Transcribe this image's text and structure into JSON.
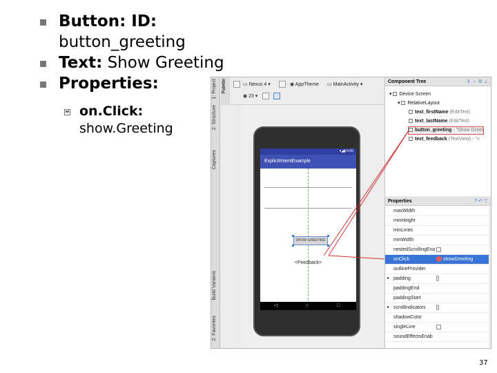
{
  "slide": {
    "bullets": [
      {
        "key": "Button: ID:",
        "value": "button_greeting"
      },
      {
        "key": "Text:",
        "value": "Show Greeting"
      },
      {
        "key": "Properties:",
        "value": ""
      }
    ],
    "sub_bullet": {
      "key": "on.Click:",
      "value": "show.Greeting"
    },
    "page_number": "37"
  },
  "ide": {
    "side_tabs": [
      "1: Project",
      "2: Structure",
      "Captures",
      "Build Variants",
      "2: Favorites"
    ],
    "palette_tab": "Palette",
    "toolbar": {
      "device": "Nexus 4",
      "theme": "AppTheme",
      "activity": "MainActivity",
      "api": "23"
    },
    "preview": {
      "status_time": "6:00",
      "app_title": "ExplicitIntentExample",
      "button_text": "SHOW GREETING",
      "feedback_text": "<Feedback>",
      "nav_back": "◁",
      "nav_home": "○",
      "nav_recent": "□"
    },
    "component_tree": {
      "title": "Component Tree",
      "nodes": [
        {
          "name": "Device Screen",
          "detail": "",
          "depth": 0
        },
        {
          "name": "RelativeLayout",
          "detail": "",
          "depth": 1
        },
        {
          "name": "text_firstName",
          "detail": "(EditText)",
          "depth": 2
        },
        {
          "name": "text_lastName",
          "detail": "(EditText)",
          "depth": 2
        },
        {
          "name": "button_greeting",
          "detail": "- \"Show Greet",
          "depth": 2
        },
        {
          "name": "text_feedback",
          "detail": "(TextView) - \"<",
          "depth": 2
        }
      ]
    },
    "properties": {
      "title": "Properties",
      "rows": [
        {
          "name": "maxWidth",
          "value": ""
        },
        {
          "name": "minHeight",
          "value": ""
        },
        {
          "name": "minLines",
          "value": ""
        },
        {
          "name": "minWidth",
          "value": ""
        },
        {
          "name": "nestedScrollingEna",
          "value": "checkbox"
        },
        {
          "name": "onClick",
          "value": "showGreeting"
        },
        {
          "name": "outlineProvider",
          "value": ""
        },
        {
          "name": "padding",
          "value": "[]"
        },
        {
          "name": "paddingEnd",
          "value": ""
        },
        {
          "name": "paddingStart",
          "value": ""
        },
        {
          "name": "scrollIndicators",
          "value": "[]"
        },
        {
          "name": "shadowColor",
          "value": ""
        },
        {
          "name": "singleLine",
          "value": "checkbox"
        },
        {
          "name": "soundEffectsEnab",
          "value": ""
        }
      ]
    }
  },
  "colors": {
    "bullet": "#777777",
    "app_primary": "#3f51b5",
    "selection_blue": "#3875d7",
    "annotation_red": "#d03030"
  }
}
